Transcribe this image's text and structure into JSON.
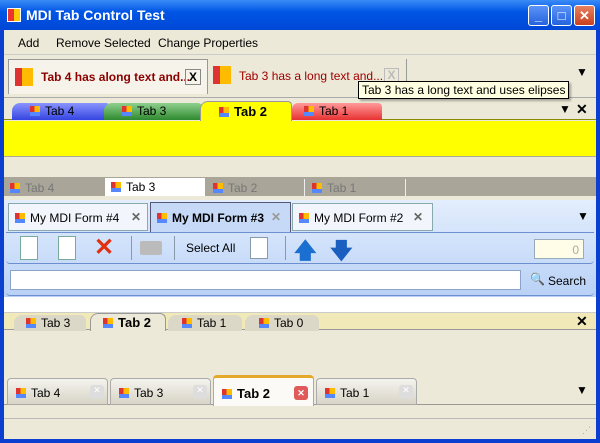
{
  "window": {
    "title": "MDI Tab Control Test"
  },
  "menu": [
    "Add",
    "Remove Selected",
    "Change Properties"
  ],
  "strip1": {
    "tabs": [
      "Tab 4 has along text and...",
      "Tab 3 has a long text and..."
    ],
    "tooltip": "Tab 3 has a long text and uses elipses"
  },
  "strip2": {
    "tabs": [
      "Tab 4",
      "Tab 3",
      "Tab 2",
      "Tab 1"
    ],
    "colors": [
      "#4a5ae8",
      "#3c9a3c",
      "#ffff00",
      "#ee3b3b"
    ]
  },
  "strip3": {
    "tabs": [
      "Tab 4",
      "Tab 3",
      "Tab 2",
      "Tab 1"
    ]
  },
  "mdi": {
    "tabs": [
      "My MDI Form #4",
      "My MDI Form #3",
      "My MDI Form #2"
    ],
    "select_all": "Select All",
    "counter": "0",
    "search_value": "",
    "search_label": "Search"
  },
  "strip5": {
    "tabs": [
      "Tab 3",
      "Tab 2",
      "Tab 1",
      "Tab 0"
    ]
  },
  "strip6": {
    "tabs": [
      "Tab 4",
      "Tab 3",
      "Tab 2",
      "Tab 1"
    ]
  }
}
